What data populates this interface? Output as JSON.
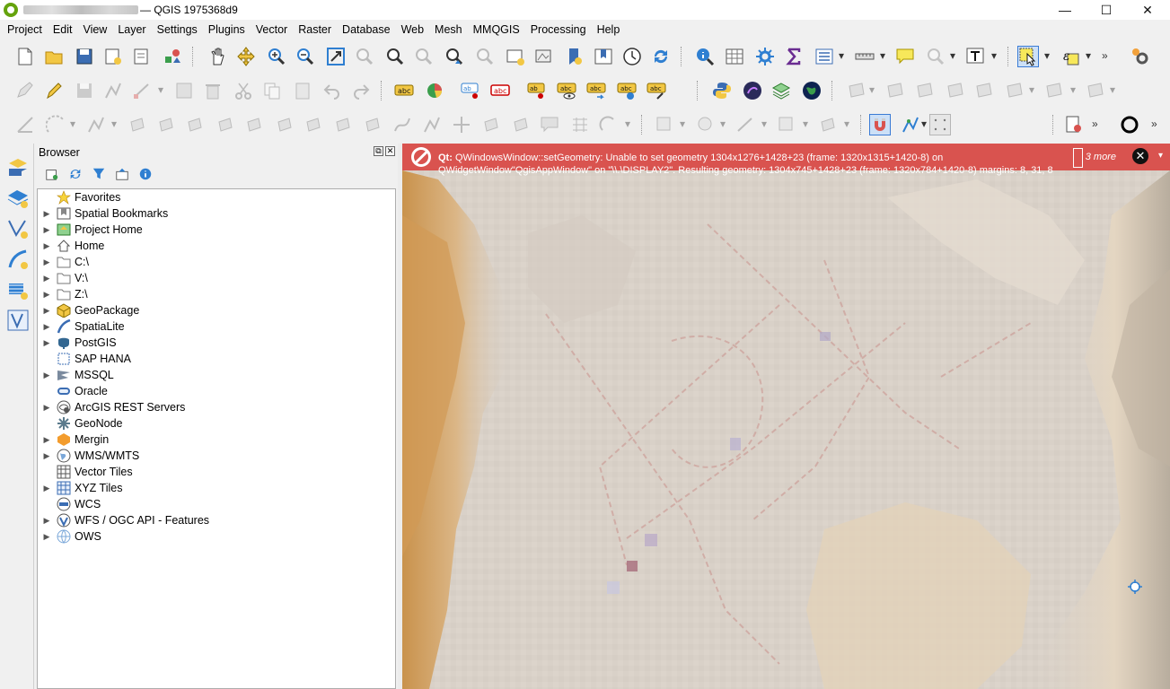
{
  "window": {
    "title": "— QGIS 1975368d9",
    "controls": {
      "minimize": "—",
      "maximize": "☐",
      "close": "✕"
    }
  },
  "menubar": [
    "Project",
    "Edit",
    "View",
    "Layer",
    "Settings",
    "Plugins",
    "Vector",
    "Raster",
    "Database",
    "Web",
    "Mesh",
    "MMQGIS",
    "Processing",
    "Help"
  ],
  "browser": {
    "title": "Browser",
    "dock_float": "⧉",
    "dock_close": "✕",
    "items": [
      {
        "label": "Favorites",
        "icon": "star-icon",
        "expandable": false
      },
      {
        "label": "Spatial Bookmarks",
        "icon": "bookmark-icon",
        "expandable": true
      },
      {
        "label": "Project Home",
        "icon": "project-home-icon",
        "expandable": true
      },
      {
        "label": "Home",
        "icon": "home-icon",
        "expandable": true
      },
      {
        "label": "C:\\",
        "icon": "folder-icon",
        "expandable": true
      },
      {
        "label": "V:\\",
        "icon": "folder-icon",
        "expandable": true
      },
      {
        "label": "Z:\\",
        "icon": "folder-icon",
        "expandable": true
      },
      {
        "label": "GeoPackage",
        "icon": "geopackage-icon",
        "expandable": true
      },
      {
        "label": "SpatiaLite",
        "icon": "spatialite-icon",
        "expandable": true
      },
      {
        "label": "PostGIS",
        "icon": "postgis-icon",
        "expandable": true
      },
      {
        "label": "SAP HANA",
        "icon": "sap-hana-icon",
        "expandable": false
      },
      {
        "label": "MSSQL",
        "icon": "mssql-icon",
        "expandable": true
      },
      {
        "label": "Oracle",
        "icon": "oracle-icon",
        "expandable": false
      },
      {
        "label": "ArcGIS REST Servers",
        "icon": "arcgis-icon",
        "expandable": true
      },
      {
        "label": "GeoNode",
        "icon": "geonode-icon",
        "expandable": false
      },
      {
        "label": "Mergin",
        "icon": "mergin-icon",
        "expandable": true
      },
      {
        "label": "WMS/WMTS",
        "icon": "wms-icon",
        "expandable": true
      },
      {
        "label": "Vector Tiles",
        "icon": "vector-tiles-icon",
        "expandable": false
      },
      {
        "label": "XYZ Tiles",
        "icon": "xyz-tiles-icon",
        "expandable": true
      },
      {
        "label": "WCS",
        "icon": "wcs-icon",
        "expandable": false
      },
      {
        "label": "WFS / OGC API - Features",
        "icon": "wfs-icon",
        "expandable": true
      },
      {
        "label": "OWS",
        "icon": "ows-icon",
        "expandable": true
      }
    ]
  },
  "message_bar": {
    "prefix": "Qt:",
    "text": "QWindowsWindow::setGeometry: Unable to set geometry 1304x1276+1428+23 (frame: 1320x1315+1420-8) on",
    "text_line2": "QWidgetWindow\"QgisAppWindow\" on \"\\\\.\\DISPLAY2\". Resulting geometry: 1304x745+1428+23 (frame: 1320x784+1420-8) margins: 8, 31, 8",
    "more": "3 more",
    "close_icon": "✕",
    "drop_icon": "▾"
  },
  "colors": {
    "message_bar": "#d9534f",
    "accent_yellow": "#f2c744",
    "accent_blue": "#2f7fd1"
  }
}
